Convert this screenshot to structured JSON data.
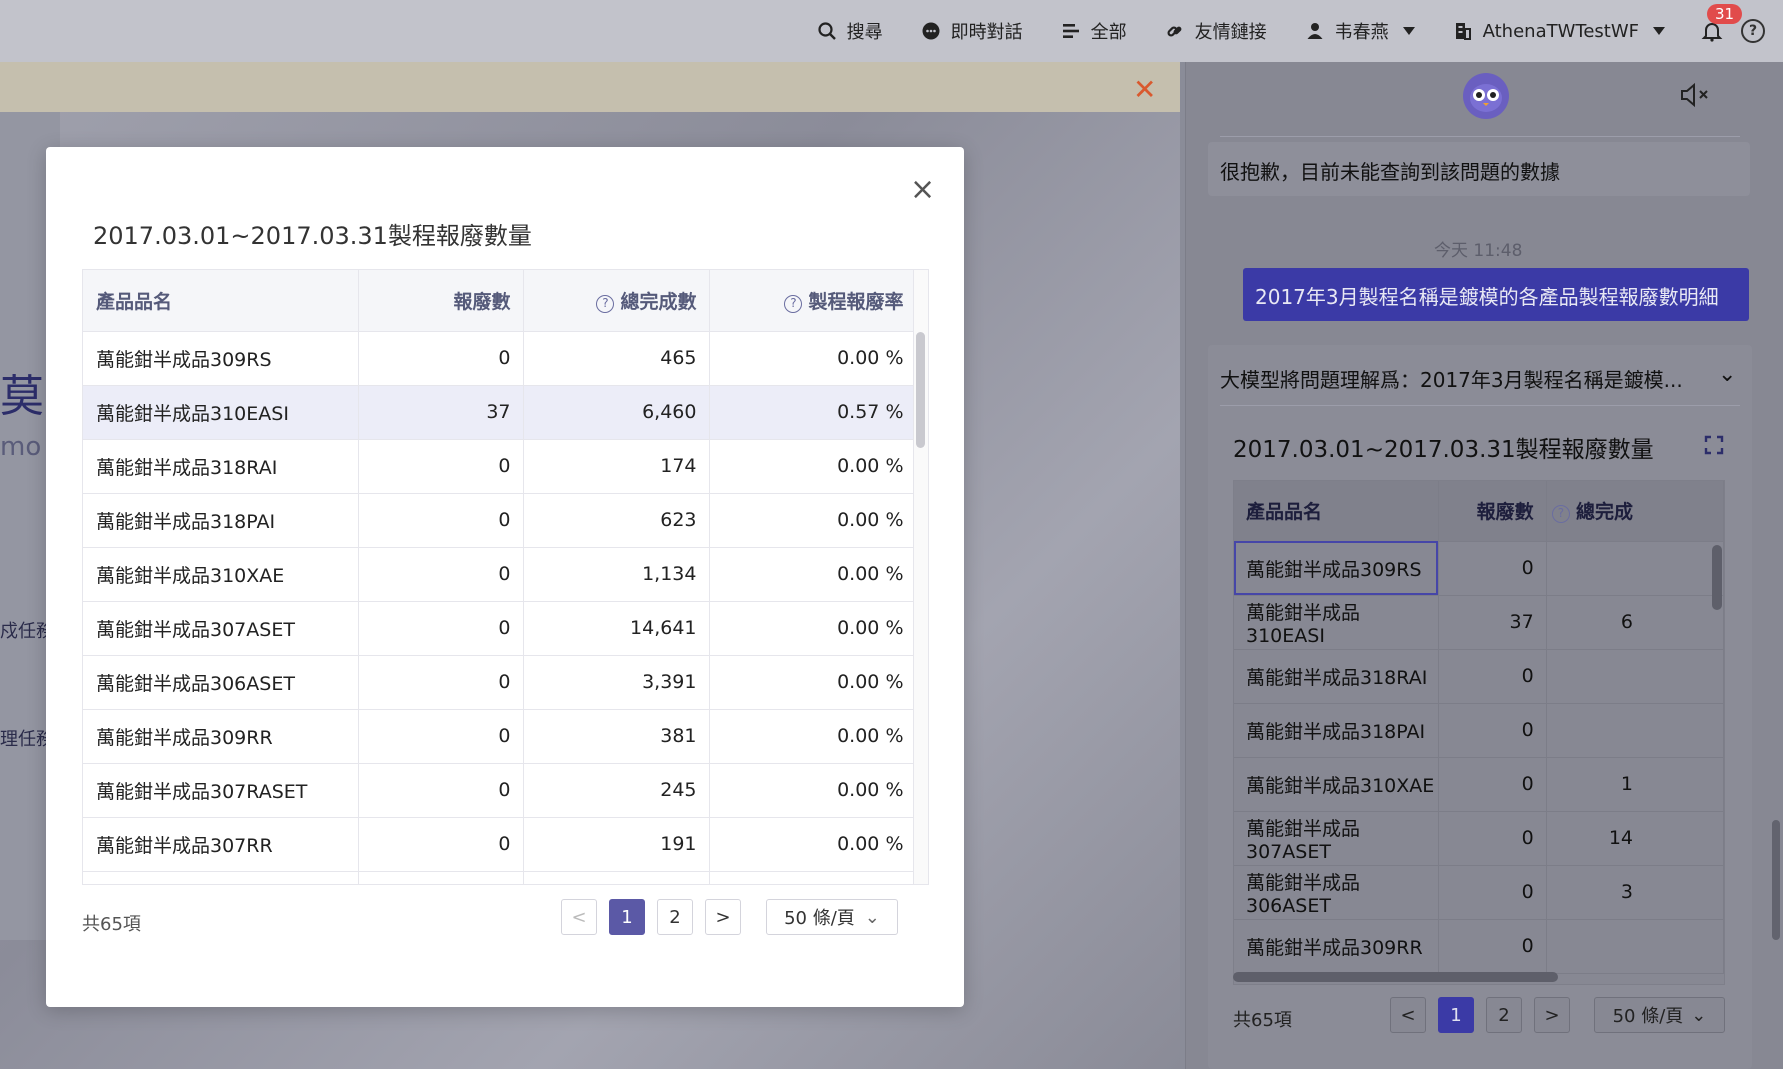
{
  "topbar": {
    "search": "搜尋",
    "chat": "即時對話",
    "all": "全部",
    "links": "友情鏈接",
    "user": "韦春燕",
    "tenant": "AthenaTWTestWF",
    "notifications": "31"
  },
  "background": {
    "frag1": "莫",
    "frag2": "mo",
    "frag3": "戍任務",
    "frag4": "理任務"
  },
  "modal": {
    "title": "2017.03.01~2017.03.31製程報廢數量",
    "columns": [
      "產品品名",
      "報廢數",
      "總完成數",
      "製程報廢率"
    ],
    "rows": [
      [
        "萬能鉗半成品309RS",
        "0",
        "465",
        "0.00 %"
      ],
      [
        "萬能鉗半成品310EASI",
        "37",
        "6,460",
        "0.57 %"
      ],
      [
        "萬能鉗半成品318RAI",
        "0",
        "174",
        "0.00 %"
      ],
      [
        "萬能鉗半成品318PAI",
        "0",
        "623",
        "0.00 %"
      ],
      [
        "萬能鉗半成品310XAE",
        "0",
        "1,134",
        "0.00 %"
      ],
      [
        "萬能鉗半成品307ASET",
        "0",
        "14,641",
        "0.00 %"
      ],
      [
        "萬能鉗半成品306ASET",
        "0",
        "3,391",
        "0.00 %"
      ],
      [
        "萬能鉗半成品309RR",
        "0",
        "381",
        "0.00 %"
      ],
      [
        "萬能鉗半成品307RASET",
        "0",
        "245",
        "0.00 %"
      ],
      [
        "萬能鉗半成品307RR",
        "0",
        "191",
        "0.00 %"
      ]
    ],
    "total": "共65項",
    "pages": [
      "1",
      "2"
    ],
    "current_page": "1",
    "page_size": "50 條/頁",
    "prev": "<",
    "next": ">"
  },
  "chat": {
    "bot_message": "很抱歉，目前未能查詢到該問題的數據",
    "time": "今天 11:48",
    "user_message": "2017年3月製程名稱是鍍模的各產品製程報廢數明細",
    "summary": "大模型將問題理解爲：2017年3月製程名稱是鍍模...",
    "table_title": "2017.03.01~2017.03.31製程報廢數量",
    "columns": [
      "產品品名",
      "報廢數",
      "總完成"
    ],
    "rows": [
      [
        "萬能鉗半成品309RS",
        "0",
        ""
      ],
      [
        "萬能鉗半成品310EASI",
        "37",
        "6"
      ],
      [
        "萬能鉗半成品318RAI",
        "0",
        ""
      ],
      [
        "萬能鉗半成品318PAI",
        "0",
        ""
      ],
      [
        "萬能鉗半成品310XAE",
        "0",
        "1"
      ],
      [
        "萬能鉗半成品307ASET",
        "0",
        "14"
      ],
      [
        "萬能鉗半成品306ASET",
        "0",
        "3"
      ],
      [
        "萬能鉗半成品309RR",
        "0",
        ""
      ]
    ],
    "total": "共65項",
    "pages": [
      "1",
      "2"
    ],
    "page_size": "50 條/頁",
    "prev": "<",
    "next": ">"
  }
}
